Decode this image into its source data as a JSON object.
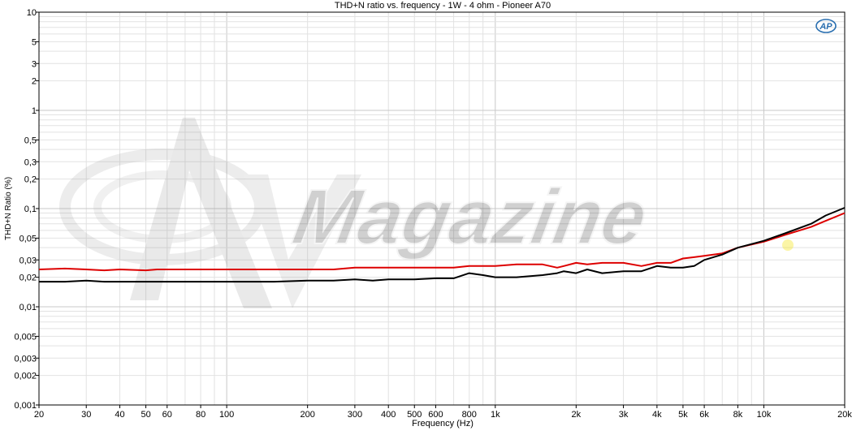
{
  "chart_data": {
    "type": "line",
    "title": "THD+N ratio vs. frequency - 1W - 4 ohm - Pioneer A70",
    "xlabel": "Frequency (Hz)",
    "ylabel": "THD+N Ratio (%)",
    "x_scale": "log",
    "y_scale": "log",
    "xlim": [
      20,
      20000
    ],
    "ylim": [
      0.001,
      10
    ],
    "grid": true,
    "x_ticks": [
      {
        "v": 20,
        "label": "20"
      },
      {
        "v": 30,
        "label": "30"
      },
      {
        "v": 40,
        "label": "40"
      },
      {
        "v": 50,
        "label": "50"
      },
      {
        "v": 60,
        "label": "60"
      },
      {
        "v": 80,
        "label": "80"
      },
      {
        "v": 100,
        "label": "100"
      },
      {
        "v": 200,
        "label": "200"
      },
      {
        "v": 300,
        "label": "300"
      },
      {
        "v": 400,
        "label": "400"
      },
      {
        "v": 500,
        "label": "500"
      },
      {
        "v": 600,
        "label": "600"
      },
      {
        "v": 800,
        "label": "800"
      },
      {
        "v": 1000,
        "label": "1k"
      },
      {
        "v": 2000,
        "label": "2k"
      },
      {
        "v": 3000,
        "label": "3k"
      },
      {
        "v": 4000,
        "label": "4k"
      },
      {
        "v": 5000,
        "label": "5k"
      },
      {
        "v": 6000,
        "label": "6k"
      },
      {
        "v": 8000,
        "label": "8k"
      },
      {
        "v": 10000,
        "label": "10k"
      },
      {
        "v": 20000,
        "label": "20k"
      }
    ],
    "y_ticks": [
      {
        "v": 10,
        "label": "10"
      },
      {
        "v": 5,
        "label": "5"
      },
      {
        "v": 3,
        "label": "3"
      },
      {
        "v": 2,
        "label": "2"
      },
      {
        "v": 1,
        "label": "1"
      },
      {
        "v": 0.5,
        "label": "0,5"
      },
      {
        "v": 0.3,
        "label": "0,3"
      },
      {
        "v": 0.2,
        "label": "0,2"
      },
      {
        "v": 0.1,
        "label": "0,1"
      },
      {
        "v": 0.05,
        "label": "0,05"
      },
      {
        "v": 0.03,
        "label": "0,03"
      },
      {
        "v": 0.02,
        "label": "0,02"
      },
      {
        "v": 0.01,
        "label": "0,01"
      },
      {
        "v": 0.005,
        "label": "0,005"
      },
      {
        "v": 0.003,
        "label": "0,003"
      },
      {
        "v": 0.002,
        "label": "0,002"
      },
      {
        "v": 0.001,
        "label": "0,001"
      }
    ],
    "series": [
      {
        "color": "#dd0000",
        "x": [
          20,
          25,
          30,
          35,
          40,
          50,
          55,
          60,
          70,
          80,
          90,
          100,
          120,
          150,
          200,
          250,
          300,
          400,
          500,
          600,
          700,
          800,
          900,
          1000,
          1200,
          1500,
          1700,
          1800,
          2000,
          2200,
          2500,
          3000,
          3500,
          4000,
          4500,
          5000,
          5500,
          6000,
          7000,
          8000,
          10000,
          12000,
          15000,
          17000,
          20000
        ],
        "y": [
          0.024,
          0.0245,
          0.024,
          0.0235,
          0.024,
          0.0235,
          0.024,
          0.024,
          0.024,
          0.024,
          0.024,
          0.024,
          0.024,
          0.024,
          0.024,
          0.024,
          0.025,
          0.025,
          0.025,
          0.025,
          0.025,
          0.026,
          0.026,
          0.026,
          0.027,
          0.027,
          0.025,
          0.026,
          0.028,
          0.027,
          0.028,
          0.028,
          0.026,
          0.028,
          0.028,
          0.031,
          0.032,
          0.033,
          0.035,
          0.04,
          0.046,
          0.054,
          0.065,
          0.075,
          0.09
        ]
      },
      {
        "color": "#000000",
        "x": [
          20,
          25,
          30,
          35,
          40,
          50,
          60,
          70,
          80,
          90,
          100,
          120,
          150,
          200,
          250,
          300,
          350,
          400,
          500,
          600,
          700,
          800,
          900,
          1000,
          1200,
          1500,
          1700,
          1800,
          2000,
          2200,
          2500,
          3000,
          3500,
          4000,
          4500,
          5000,
          5500,
          6000,
          7000,
          8000,
          10000,
          12000,
          15000,
          17000,
          20000
        ],
        "y": [
          0.018,
          0.018,
          0.0185,
          0.018,
          0.018,
          0.018,
          0.018,
          0.018,
          0.018,
          0.018,
          0.018,
          0.018,
          0.018,
          0.0185,
          0.0185,
          0.019,
          0.0185,
          0.019,
          0.019,
          0.0195,
          0.0195,
          0.022,
          0.021,
          0.02,
          0.02,
          0.021,
          0.022,
          0.023,
          0.022,
          0.024,
          0.022,
          0.023,
          0.023,
          0.026,
          0.025,
          0.025,
          0.026,
          0.03,
          0.034,
          0.04,
          0.047,
          0.056,
          0.07,
          0.085,
          0.102
        ]
      }
    ]
  },
  "watermark": {
    "text": "Magazine",
    "logo_letters": "AV"
  },
  "logo": {
    "text": "AP"
  }
}
